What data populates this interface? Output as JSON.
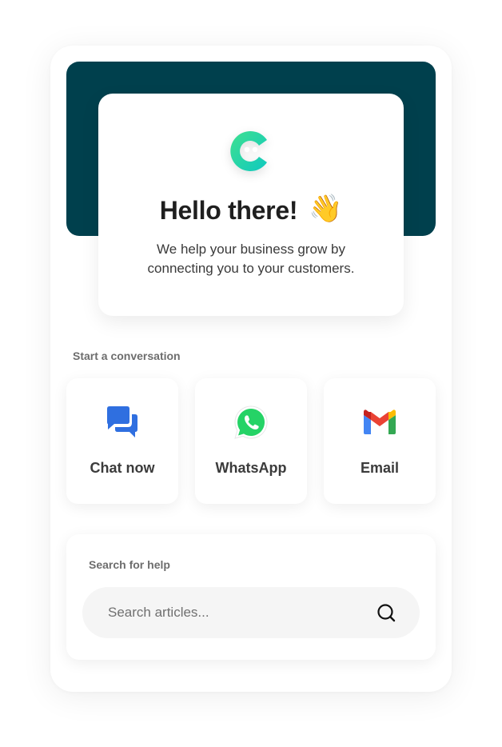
{
  "hero": {
    "title": "Hello there!",
    "wave_emoji": "👋",
    "tagline": "We help your business grow by connecting you to your customers.",
    "logo_icon": "brand-c-logo-icon",
    "background_color": "#00404d"
  },
  "channels_section": {
    "label": "Start a conversation",
    "items": [
      {
        "label": "Chat now",
        "icon": "chat-bubbles-icon",
        "color": "#2f6fe0"
      },
      {
        "label": "WhatsApp",
        "icon": "whatsapp-icon",
        "color": "#25d366"
      },
      {
        "label": "Email",
        "icon": "gmail-icon",
        "color": "#ea4335"
      }
    ]
  },
  "help": {
    "label": "Search for help",
    "search_placeholder": "Search articles...",
    "search_icon": "search-icon"
  }
}
